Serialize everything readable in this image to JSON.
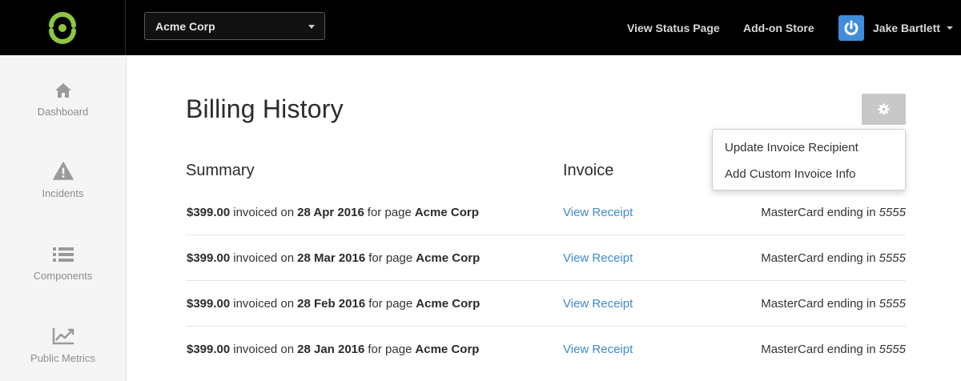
{
  "header": {
    "org_selector": {
      "value": "Acme Corp"
    },
    "nav": {
      "status_page": "View Status Page",
      "addon_store": "Add-on Store"
    },
    "user": {
      "name": "Jake Bartlett"
    }
  },
  "sidebar": {
    "items": [
      {
        "label": "Dashboard",
        "icon": "home-icon"
      },
      {
        "label": "Incidents",
        "icon": "warning-icon"
      },
      {
        "label": "Components",
        "icon": "list-icon"
      },
      {
        "label": "Public Metrics",
        "icon": "line-chart-icon"
      }
    ]
  },
  "main": {
    "title": "Billing History",
    "settings_menu": {
      "items": [
        "Update Invoice Recipient",
        "Add Custom Invoice Info"
      ]
    },
    "columns": {
      "summary": "Summary",
      "invoice": "Invoice"
    },
    "rows": [
      {
        "amount": "$399.00",
        "text1": "invoiced on",
        "date": "28 Apr 2016",
        "text2": "for page",
        "page": "Acme Corp",
        "link": "View Receipt",
        "card_text": "MasterCard ending in",
        "card_last4": "5555"
      },
      {
        "amount": "$399.00",
        "text1": "invoiced on",
        "date": "28 Mar 2016",
        "text2": "for page",
        "page": "Acme Corp",
        "link": "View Receipt",
        "card_text": "MasterCard ending in",
        "card_last4": "5555"
      },
      {
        "amount": "$399.00",
        "text1": "invoiced on",
        "date": "28 Feb 2016",
        "text2": "for page",
        "page": "Acme Corp",
        "link": "View Receipt",
        "card_text": "MasterCard ending in",
        "card_last4": "5555"
      },
      {
        "amount": "$399.00",
        "text1": "invoiced on",
        "date": "28 Jan 2016",
        "text2": "for page",
        "page": "Acme Corp",
        "link": "View Receipt",
        "card_text": "MasterCard ending in",
        "card_last4": "5555"
      }
    ]
  },
  "colors": {
    "brand_green": "#8dc63f",
    "link_blue": "#3f8ad1",
    "topbar": "#000000",
    "avatar_blue": "#3f8ddc"
  }
}
